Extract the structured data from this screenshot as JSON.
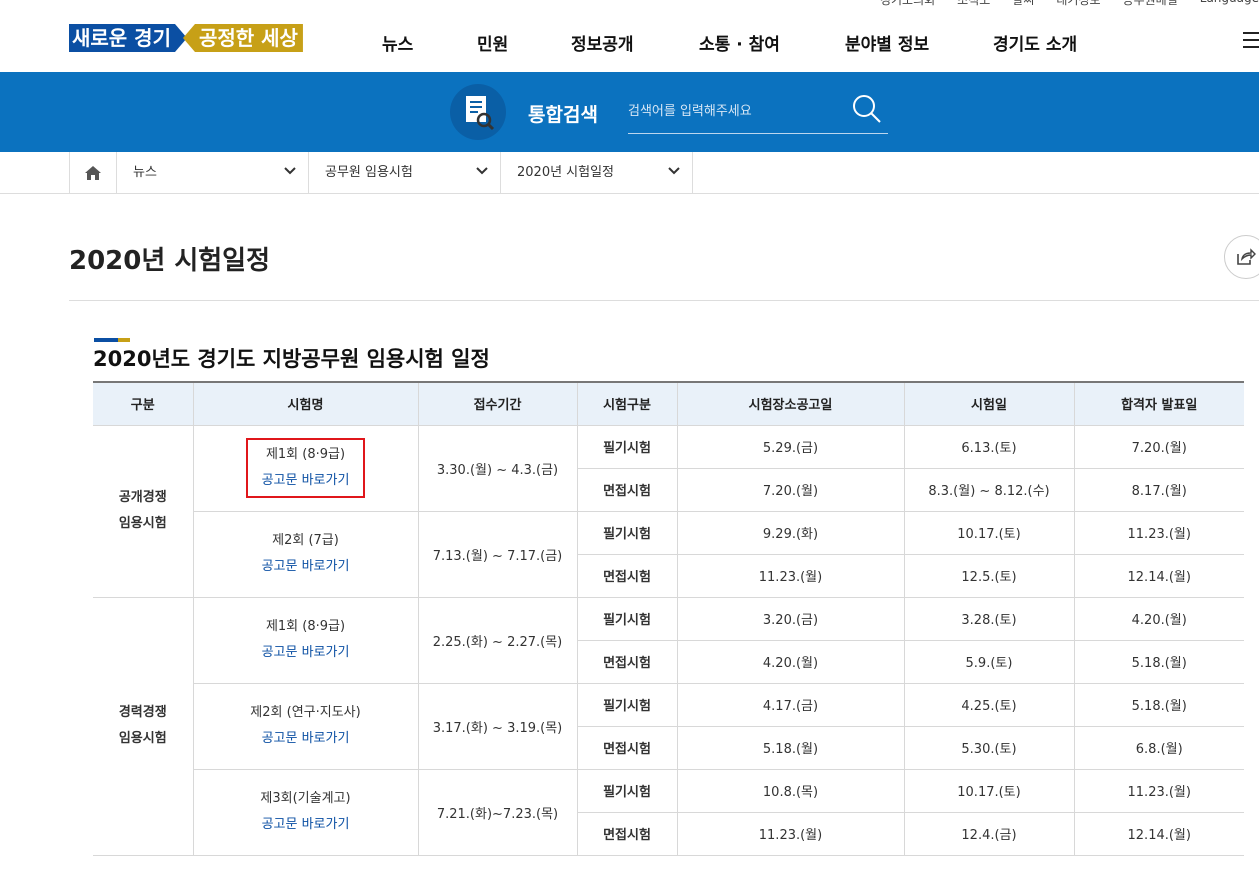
{
  "utility": [
    "경기도의회",
    "조직도",
    "날씨",
    "대기정보",
    "공무원메일",
    "Language"
  ],
  "logo": {
    "part1": "새로운 경기",
    "part2": "공정한 세상"
  },
  "gnb": [
    "뉴스",
    "민원",
    "정보공개",
    "소통 · 참여",
    "분야별 정보",
    "경기도 소개"
  ],
  "search": {
    "title": "통합검색",
    "placeholder": "검색어를 입력해주세요"
  },
  "breadcrumb": [
    "뉴스",
    "공무원 임용시험",
    "2020년 시험일정"
  ],
  "page_title": "2020년 시험일정",
  "section_title": "2020년도 경기도 지방공무원 임용시험 일정",
  "colors": {
    "brand_blue": "#0b4fa3",
    "brand_gold": "#c7a017",
    "search_band": "#0b72bf",
    "highlight": "#e0161b"
  },
  "table": {
    "headers": [
      "구분",
      "시험명",
      "접수기간",
      "시험구분",
      "시험장소공고일",
      "시험일",
      "합격자 발표일"
    ],
    "link_label": "공고문 바로가기",
    "groups": [
      {
        "category": [
          "공개경쟁",
          "임용시험"
        ],
        "rounds": [
          {
            "name": "제1회 (8·9급)",
            "period": "3.30.(월) ~ 4.3.(금)",
            "rows": [
              {
                "type": "필기시험",
                "notice": "5.29.(금)",
                "exam": "6.13.(토)",
                "result": "7.20.(월)"
              },
              {
                "type": "면접시험",
                "notice": "7.20.(월)",
                "exam": "8.3.(월) ~ 8.12.(수)",
                "result": "8.17.(월)"
              }
            ]
          },
          {
            "name": "제2회 (7급)",
            "period": "7.13.(월) ~ 7.17.(금)",
            "rows": [
              {
                "type": "필기시험",
                "notice": "9.29.(화)",
                "exam": "10.17.(토)",
                "result": "11.23.(월)"
              },
              {
                "type": "면접시험",
                "notice": "11.23.(월)",
                "exam": "12.5.(토)",
                "result": "12.14.(월)"
              }
            ]
          }
        ]
      },
      {
        "category": [
          "경력경쟁",
          "임용시험"
        ],
        "rounds": [
          {
            "name": "제1회 (8·9급)",
            "period": "2.25.(화) ~ 2.27.(목)",
            "rows": [
              {
                "type": "필기시험",
                "notice": "3.20.(금)",
                "exam": "3.28.(토)",
                "result": "4.20.(월)"
              },
              {
                "type": "면접시험",
                "notice": "4.20.(월)",
                "exam": "5.9.(토)",
                "result": "5.18.(월)"
              }
            ]
          },
          {
            "name": "제2회 (연구·지도사)",
            "period": "3.17.(화) ~ 3.19.(목)",
            "rows": [
              {
                "type": "필기시험",
                "notice": "4.17.(금)",
                "exam": "4.25.(토)",
                "result": "5.18.(월)"
              },
              {
                "type": "면접시험",
                "notice": "5.18.(월)",
                "exam": "5.30.(토)",
                "result": "6.8.(월)"
              }
            ]
          },
          {
            "name": "제3회(기술계고)",
            "period": "7.21.(화)~7.23.(목)",
            "rows": [
              {
                "type": "필기시험",
                "notice": "10.8.(목)",
                "exam": "10.17.(토)",
                "result": "11.23.(월)"
              },
              {
                "type": "면접시험",
                "notice": "11.23.(월)",
                "exam": "12.4.(금)",
                "result": "12.14.(월)"
              }
            ]
          }
        ]
      }
    ]
  }
}
